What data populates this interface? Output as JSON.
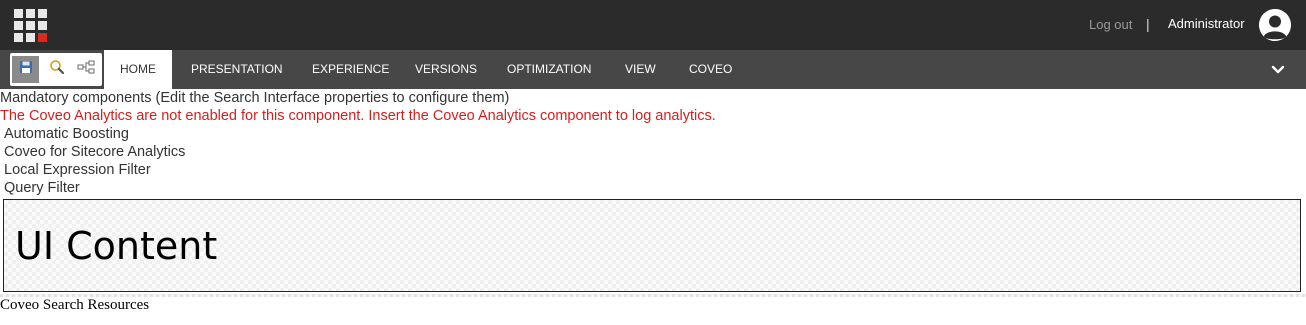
{
  "topbar": {
    "launchpad_icon": "launchpad-grid-icon",
    "logout_label": "Log out",
    "separator": "|",
    "user_name": "Administrator",
    "avatar_icon": "user-avatar-icon",
    "accent_color": "#dc291e"
  },
  "ribbon": {
    "quick_actions": [
      {
        "icon": "save-icon"
      },
      {
        "icon": "search-icon"
      },
      {
        "icon": "navigation-tree-icon"
      }
    ],
    "tabs": [
      {
        "label": "HOME",
        "active": true
      },
      {
        "label": "PRESENTATION"
      },
      {
        "label": "EXPERIENCE"
      },
      {
        "label": "VERSIONS"
      },
      {
        "label": "OPTIMIZATION"
      },
      {
        "label": "VIEW"
      },
      {
        "label": "COVEO"
      }
    ],
    "collapse_icon": "chevron-down-icon"
  },
  "content": {
    "mandatory_text": "Mandatory components (Edit the Search Interface properties to configure them)",
    "warning_text": "The Coveo Analytics are not enabled for this component. Insert the Coveo Analytics component to log analytics.",
    "warning_color": "#d41f1f",
    "components": [
      "Automatic Boosting",
      "Coveo for Sitecore Analytics",
      "Local Expression Filter",
      "Query Filter"
    ],
    "ui_content_label": "UI Content",
    "resources_label": "Coveo Search Resources"
  }
}
